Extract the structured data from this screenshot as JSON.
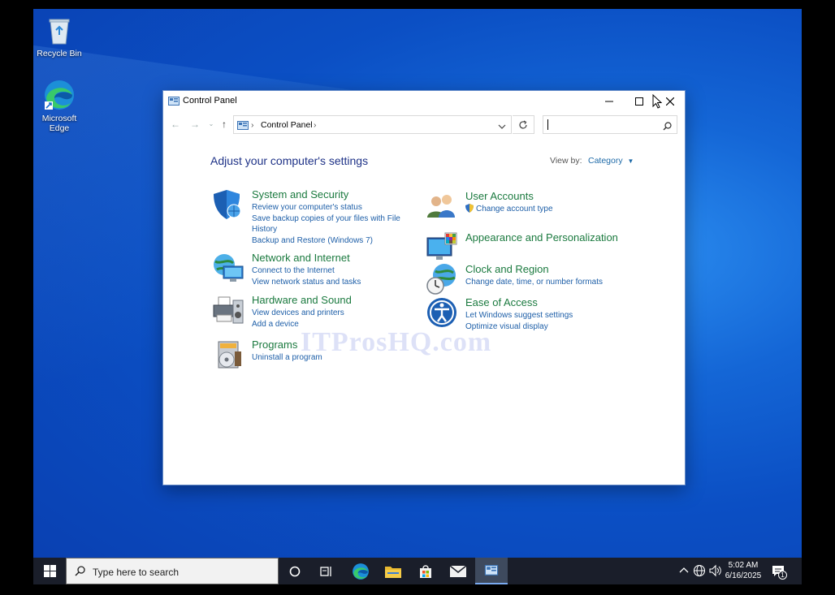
{
  "desktop": {
    "icons": [
      {
        "label": "Recycle Bin"
      },
      {
        "label": "Microsoft Edge"
      }
    ]
  },
  "window": {
    "title": "Control Panel",
    "address": {
      "root": "Control Panel"
    },
    "search": {
      "placeholder": ""
    },
    "heading": "Adjust your computer's settings",
    "view_by_label": "View by:",
    "view_by_value": "Category",
    "categories_left": [
      {
        "title": "System and Security",
        "icon": "shield-icon",
        "links": [
          "Review your computer's status",
          "Save backup copies of your files with File History",
          "Backup and Restore (Windows 7)"
        ]
      },
      {
        "title": "Network and Internet",
        "icon": "globe-network-icon",
        "links": [
          "Connect to the Internet",
          "View network status and tasks"
        ]
      },
      {
        "title": "Hardware and Sound",
        "icon": "printer-speaker-icon",
        "links": [
          "View devices and printers",
          "Add a device"
        ]
      },
      {
        "title": "Programs",
        "icon": "programs-disc-icon",
        "links": [
          "Uninstall a program"
        ]
      }
    ],
    "categories_right": [
      {
        "title": "User Accounts",
        "icon": "users-icon",
        "links": [
          "Change account type"
        ]
      },
      {
        "title": "Appearance and Personalization",
        "icon": "monitor-palette-icon",
        "links": []
      },
      {
        "title": "Clock and Region",
        "icon": "clock-globe-icon",
        "links": [
          "Change date, time, or number formats"
        ]
      },
      {
        "title": "Ease of Access",
        "icon": "ease-of-access-icon",
        "links": [
          "Let Windows suggest settings",
          "Optimize visual display"
        ]
      }
    ],
    "watermark": "ITProsHQ.com"
  },
  "taskbar": {
    "search_placeholder": "Type here to search",
    "time": "5:02 AM",
    "date": "6/16/2025",
    "notification_count": "1"
  },
  "colors": {
    "category_title": "#1b7a3f",
    "link": "#1e5fa8",
    "heading": "#1e3287",
    "taskbar": "#1a1e2a"
  }
}
